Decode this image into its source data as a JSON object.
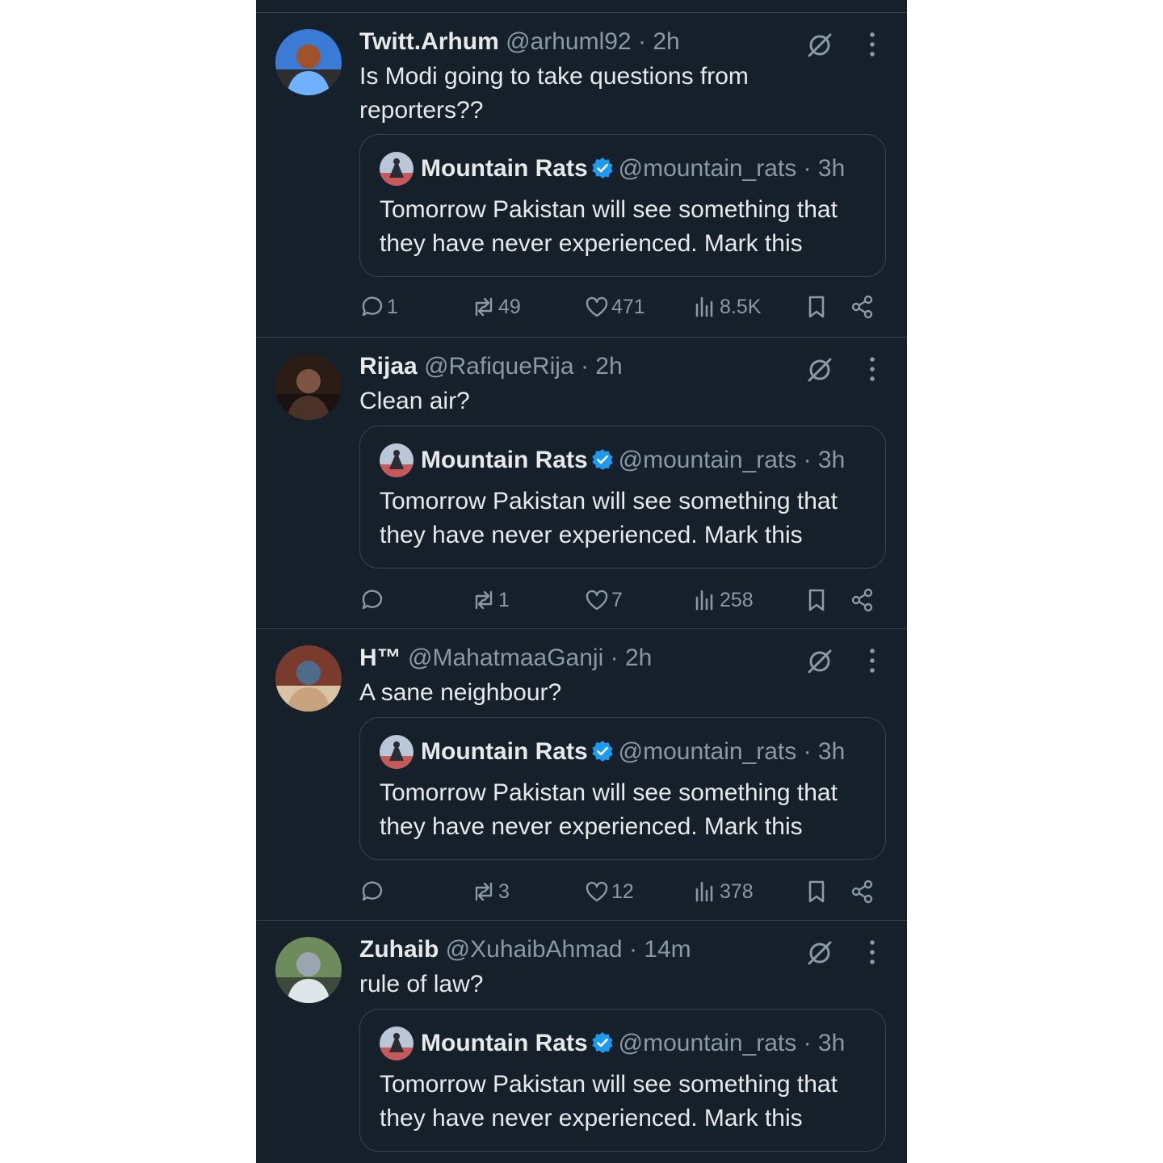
{
  "colors": {
    "background": "#15202b",
    "text": "#e7e9ea",
    "muted": "#8b98a5",
    "verified": "#1d9bf0",
    "border": "#38444d"
  },
  "icons": {
    "reply": "reply-icon",
    "retweet": "retweet-icon",
    "like": "like-icon",
    "views": "views-icon",
    "bookmark": "bookmark-icon",
    "share": "share-icon",
    "grok": "grok-icon",
    "more": "more-icon",
    "verified": "verified-badge-icon"
  },
  "separator": "·",
  "tweets": [
    {
      "name": "Twitt.Arhum",
      "handle": "@arhuml92",
      "time": "2h",
      "text": "Is Modi going to take questions from reporters??",
      "quote": {
        "name": "Mountain Rats",
        "handle": "@mountain_rats",
        "time": "3h",
        "text": "Tomorrow Pakistan will see something that they have never experienced. Mark this"
      },
      "stats": {
        "replies": "1",
        "retweets": "49",
        "likes": "471",
        "views": "8.5K"
      }
    },
    {
      "name": "Rijaa",
      "handle": "@RafiqueRija",
      "time": "2h",
      "text": "Clean air?",
      "quote": {
        "name": "Mountain Rats",
        "handle": "@mountain_rats",
        "time": "3h",
        "text": "Tomorrow Pakistan will see something that they have never experienced. Mark this"
      },
      "stats": {
        "replies": "",
        "retweets": "1",
        "likes": "7",
        "views": "258"
      }
    },
    {
      "name": "H™",
      "handle": "@MahatmaaGanji",
      "time": "2h",
      "text": "A sane neighbour?",
      "quote": {
        "name": "Mountain Rats",
        "handle": "@mountain_rats",
        "time": "3h",
        "text": "Tomorrow Pakistan will see something that they have never experienced. Mark this"
      },
      "stats": {
        "replies": "",
        "retweets": "3",
        "likes": "12",
        "views": "378"
      }
    },
    {
      "name": "Zuhaib",
      "handle": "@XuhaibAhmad",
      "time": "14m",
      "text": "rule of law?",
      "quote": {
        "name": "Mountain Rats",
        "handle": "@mountain_rats",
        "time": "3h",
        "text": "Tomorrow Pakistan will see something that they have never experienced. Mark this"
      }
    }
  ]
}
